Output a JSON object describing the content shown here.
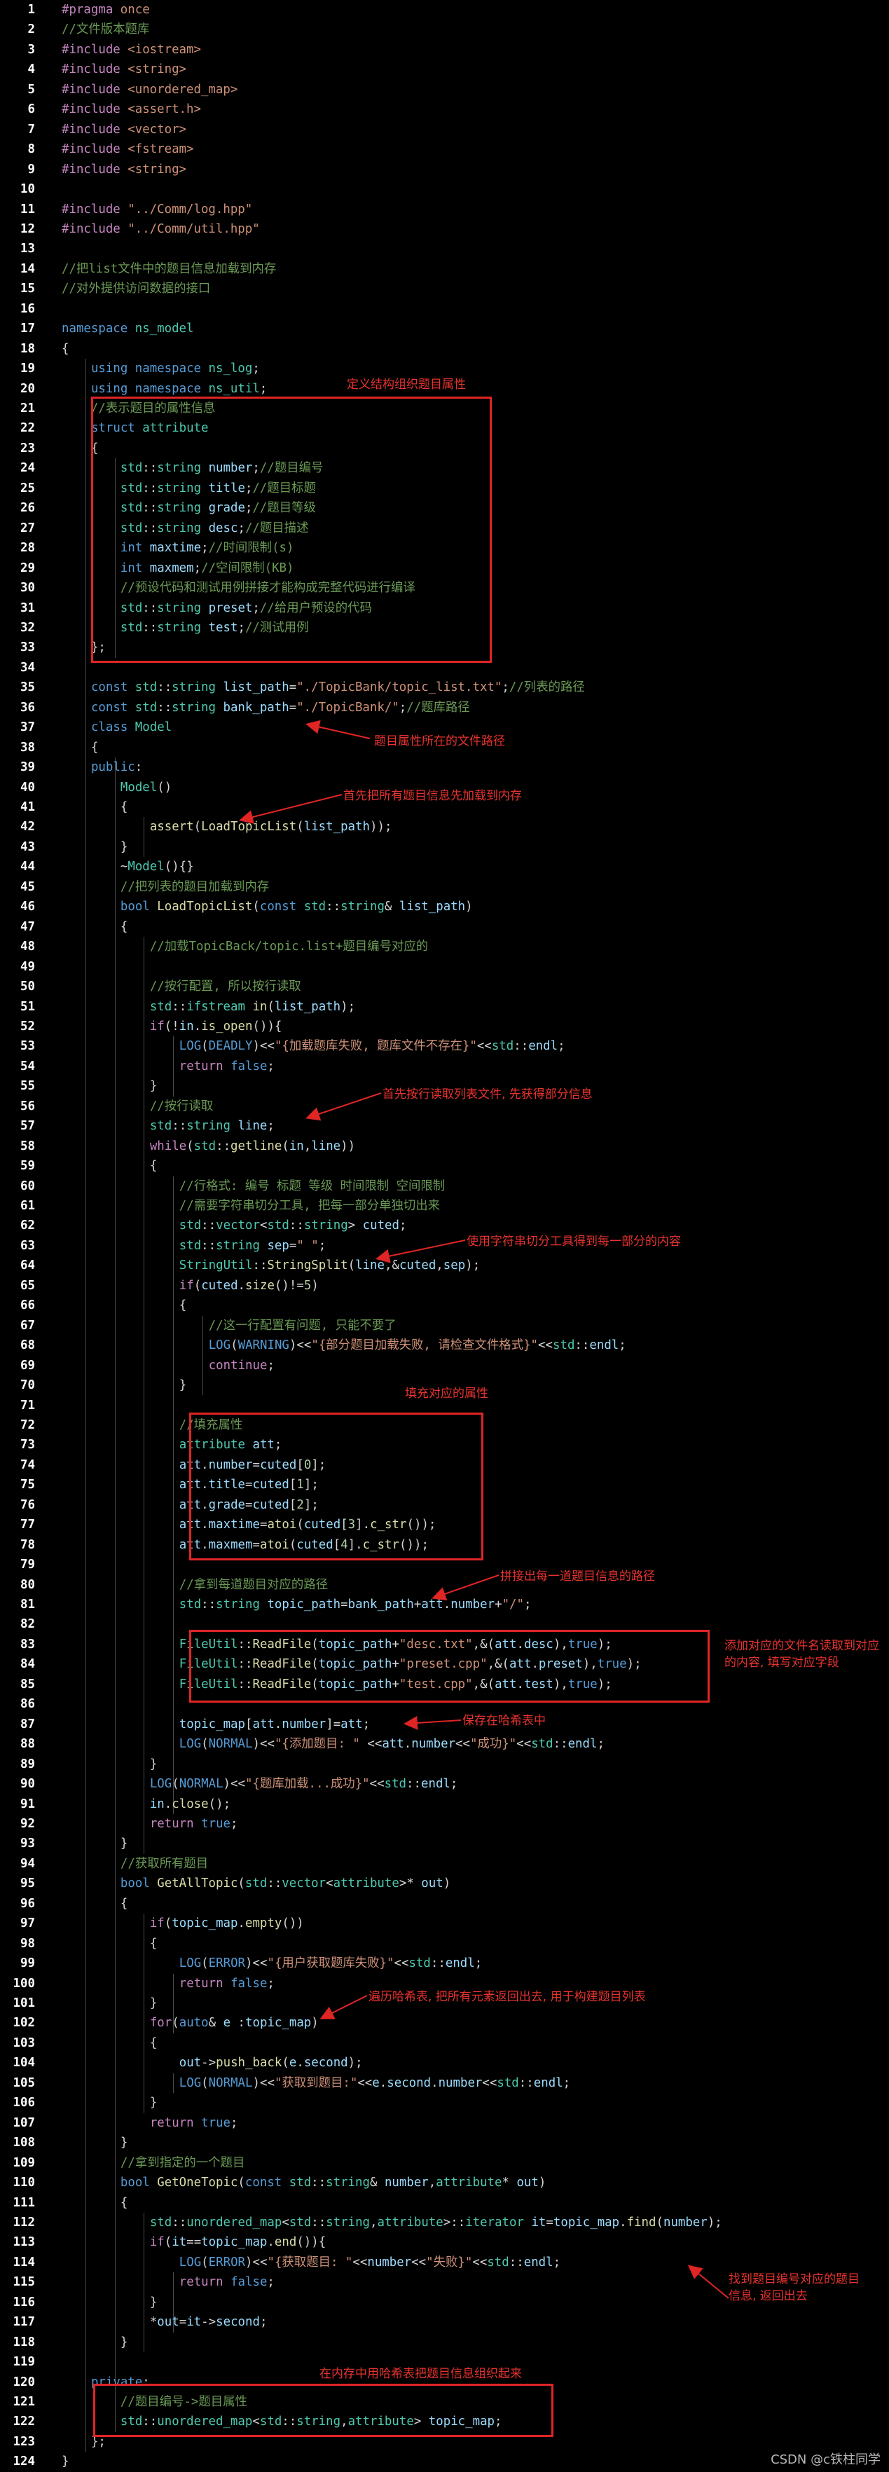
{
  "colors": {
    "background": "#000000",
    "line_number": "#ffffff",
    "default": "#d4d4d4",
    "preprocessor": "#c586c0",
    "keyword": "#569cd6",
    "control": "#c586c0",
    "type": "#4ec9b0",
    "function": "#dcdcaa",
    "string": "#ce9178",
    "comment": "#6a9955",
    "variable": "#9cdcfe",
    "number": "#b5cea8",
    "macro": "#569cd6",
    "annotation": "#e8332f"
  },
  "code_lines": [
    "#pragma once",
    "//文件版本题库",
    "#include <iostream>",
    "#include <string>",
    "#include <unordered_map>",
    "#include <assert.h>",
    "#include <vector>",
    "#include <fstream>",
    "#include <string>",
    "",
    "#include \"../Comm/log.hpp\"",
    "#include \"../Comm/util.hpp\"",
    "",
    "//把list文件中的题目信息加载到内存",
    "//对外提供访问数据的接口",
    "",
    "namespace ns_model",
    "{",
    "    using namespace ns_log;",
    "    using namespace ns_util;",
    "    //表示题目的属性信息",
    "    struct attribute",
    "    {",
    "        std::string number;//题目编号",
    "        std::string title;//题目标题",
    "        std::string grade;//题目等级",
    "        std::string desc;//题目描述",
    "        int maxtime;//时间限制(s)",
    "        int maxmem;//空间限制(KB)",
    "        //预设代码和测试用例拼接才能构成完整代码进行编译",
    "        std::string preset;//给用户预设的代码",
    "        std::string test;//测试用例",
    "    };",
    "",
    "    const std::string list_path=\"./TopicBank/topic_list.txt\";//列表的路径",
    "    const std::string bank_path=\"./TopicBank/\";//题库路径",
    "    class Model",
    "    {",
    "    public:",
    "        Model()",
    "        {",
    "            assert(LoadTopicList(list_path));",
    "        }",
    "        ~Model(){}",
    "        //把列表的题目加载到内存",
    "        bool LoadTopicList(const std::string& list_path)",
    "        {",
    "            //加载TopicBack/topic.list+题目编号对应的",
    "",
    "            //按行配置, 所以按行读取",
    "            std::ifstream in(list_path);",
    "            if(!in.is_open()){",
    "                LOG(DEADLY)<<\"{加载题库失败, 题库文件不存在}\"<<std::endl;",
    "                return false;",
    "            }",
    "            //按行读取",
    "            std::string line;",
    "            while(std::getline(in,line))",
    "            {",
    "                //行格式: 编号 标题 等级 时间限制 空间限制",
    "                //需要字符串切分工具, 把每一部分单独切出来",
    "                std::vector<std::string> cuted;",
    "                std::string sep=\" \";",
    "                StringUtil::StringSplit(line,&cuted,sep);",
    "                if(cuted.size()!=5)",
    "                {",
    "                    //这一行配置有问题, 只能不要了",
    "                    LOG(WARNING)<<\"{部分题目加载失败, 请检查文件格式}\"<<std::endl;",
    "                    continue;",
    "                }",
    "",
    "                //填充属性",
    "                attribute att;",
    "                att.number=cuted[0];",
    "                att.title=cuted[1];",
    "                att.grade=cuted[2];",
    "                att.maxtime=atoi(cuted[3].c_str());",
    "                att.maxmem=atoi(cuted[4].c_str());",
    "",
    "                //拿到每道题目对应的路径",
    "                std::string topic_path=bank_path+att.number+\"/\";",
    "",
    "                FileUtil::ReadFile(topic_path+\"desc.txt\",&(att.desc),true);",
    "                FileUtil::ReadFile(topic_path+\"preset.cpp\",&(att.preset),true);",
    "                FileUtil::ReadFile(topic_path+\"test.cpp\",&(att.test),true);",
    "",
    "                topic_map[att.number]=att;",
    "                LOG(NORMAL)<<\"{添加题目: \" <<att.number<<\"成功}\"<<std::endl;",
    "            }",
    "            LOG(NORMAL)<<\"{题库加载...成功}\"<<std::endl;",
    "            in.close();",
    "            return true;",
    "        }",
    "        //获取所有题目",
    "        bool GetAllTopic(std::vector<attribute>* out)",
    "        {",
    "            if(topic_map.empty())",
    "            {",
    "                LOG(ERROR)<<\"{用户获取题库失败}\"<<std::endl;",
    "                return false;",
    "            }",
    "            for(auto& e :topic_map)",
    "            {",
    "                out->push_back(e.second);",
    "                LOG(NORMAL)<<\"获取到题目:\"<<e.second.number<<std::endl;",
    "            }",
    "            return true;",
    "        }",
    "        //拿到指定的一个题目",
    "        bool GetOneTopic(const std::string& number,attribute* out)",
    "        {",
    "            std::unordered_map<std::string,attribute>::iterator it=topic_map.find(number);",
    "            if(it==topic_map.end()){",
    "                LOG(ERROR)<<\"{获取题目: \"<<number<<\"失败}\"<<std::endl;",
    "                return false;",
    "            }",
    "            *out=it->second;",
    "        }",
    "",
    "    private:",
    "        //题目编号->题目属性",
    "        std::unordered_map<std::string,attribute> topic_map;",
    "    };",
    "}"
  ],
  "annotations": [
    {
      "text": "定义结构组织题目属性"
    },
    {
      "text": "题目属性所在的文件路径"
    },
    {
      "text": "首先把所有题目信息先加载到内存"
    },
    {
      "text": "首先按行读取列表文件, 先获得部分信息"
    },
    {
      "text": "使用字符串切分工具得到每一部分的内容"
    },
    {
      "text": "填充对应的属性"
    },
    {
      "text": "拼接出每一道题目信息的路径"
    },
    {
      "text": "添加对应的文件名读取到对应的内容, 填写对应字段"
    },
    {
      "text": "保存在哈希表中"
    },
    {
      "text": "遍历哈希表, 把所有元素返回出去, 用于构建题目列表"
    },
    {
      "text": "找到题目编号对应的题目信息, 返回出去"
    },
    {
      "text": "在内存中用哈希表把题目信息组织起来"
    }
  ],
  "watermark": "CSDN @c铁柱同学"
}
